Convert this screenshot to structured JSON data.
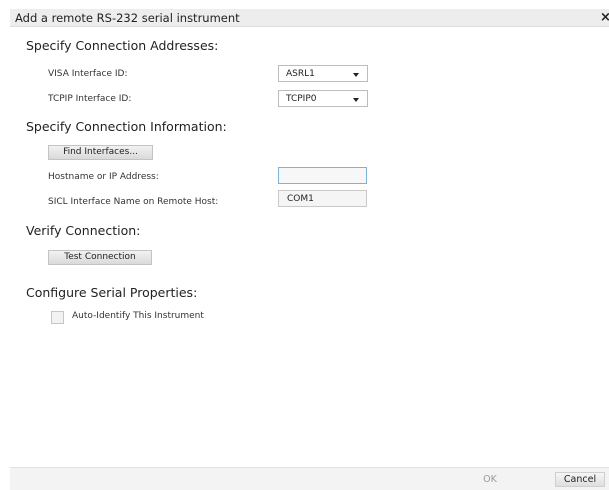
{
  "dialog": {
    "title": "Add a remote RS-232 serial instrument",
    "close_glyph": "×"
  },
  "addresses": {
    "heading": "Specify Connection Addresses:",
    "visa_label": "VISA Interface ID:",
    "visa_value": "ASRL1",
    "tcpip_label": "TCPIP Interface ID:",
    "tcpip_value": "TCPIP0"
  },
  "connection_info": {
    "heading": "Specify Connection Information:",
    "find_button": "Find Interfaces...",
    "hostname_label": "Hostname or IP Address:",
    "hostname_value": "",
    "sicl_label": "SICL Interface Name on Remote Host:",
    "sicl_value": "COM1"
  },
  "verify": {
    "heading": "Verify Connection:",
    "test_button": "Test Connection"
  },
  "serial": {
    "heading": "Configure Serial Properties:",
    "auto_identify_label": "Auto-Identify This Instrument",
    "auto_identify_checked": false
  },
  "footer": {
    "ok_label": "OK",
    "cancel_label": "Cancel"
  },
  "icons": {
    "close": "close-icon",
    "dropdown": "chevron-down-icon"
  }
}
